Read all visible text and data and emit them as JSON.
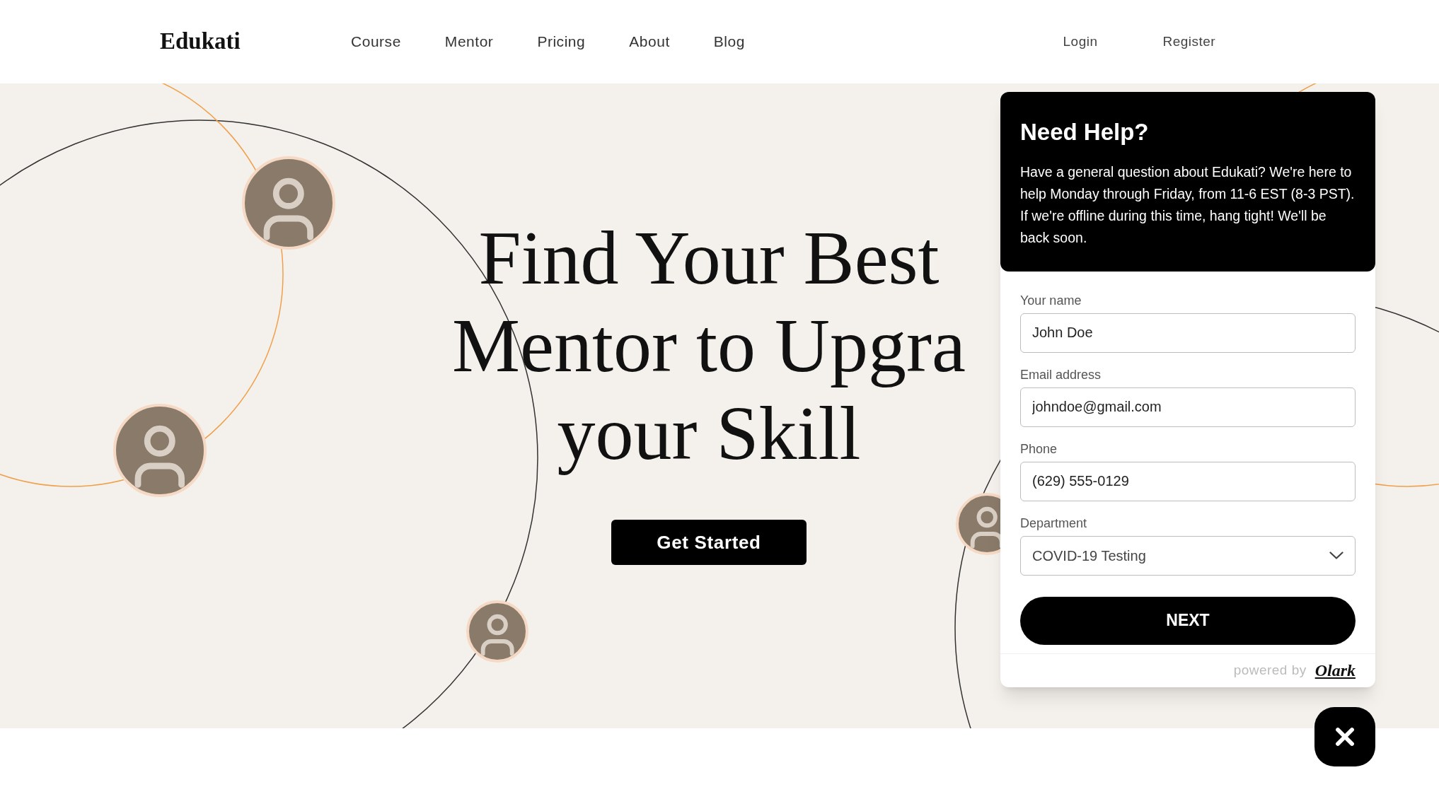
{
  "header": {
    "logo": "Edukati",
    "nav": [
      {
        "label": "Course"
      },
      {
        "label": "Mentor"
      },
      {
        "label": "Pricing"
      },
      {
        "label": "About"
      },
      {
        "label": "Blog"
      }
    ],
    "auth": [
      {
        "label": "Login"
      },
      {
        "label": "Register"
      }
    ]
  },
  "hero": {
    "heading_lines": [
      "Find Your Best",
      "Mentor to Upgra",
      "your Skill"
    ],
    "cta": "Get Started"
  },
  "chat": {
    "title": "Need Help?",
    "message": "Have a general question about Edukati? We're here to help Monday through Friday, from 11-6 EST (8-3 PST). If we're offline during this time, hang tight! We'll be back soon.",
    "fields": [
      {
        "kind": "text",
        "label": "Your name",
        "value": "John Doe"
      },
      {
        "kind": "text",
        "label": "Email address",
        "value": "johndoe@gmail.com"
      },
      {
        "kind": "text",
        "label": "Phone",
        "value": "(629) 555-0129"
      },
      {
        "kind": "select",
        "label": "Department",
        "value": "COVID-19 Testing"
      }
    ],
    "submit": "NEXT",
    "powered_by": "powered by",
    "brand": "Olark"
  }
}
